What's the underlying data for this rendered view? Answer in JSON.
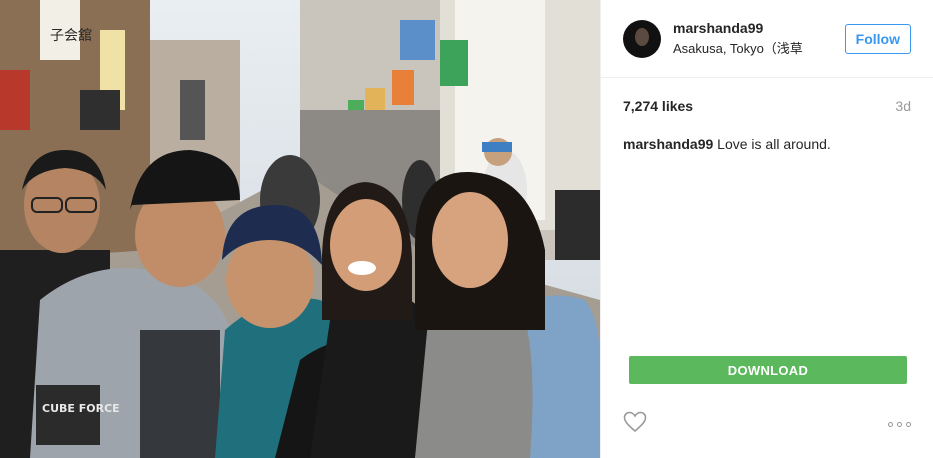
{
  "post": {
    "author": {
      "username": "marshanda99",
      "location": "Asakusa, Tokyo（浅草"
    },
    "follow_label": "Follow",
    "likes": "7,274 likes",
    "time": "3d",
    "caption": {
      "username": "marshanda99",
      "text": "Love is all around."
    },
    "download_label": "DOWNLOAD",
    "photo": {
      "sign_text": "子会舘",
      "hoodie_text": "CUBE FORCE"
    }
  },
  "icons": {
    "like": "heart-outline-icon",
    "more": "more-dots-icon"
  },
  "colors": {
    "follow": "#3897f0",
    "download": "#5cb85c",
    "muted": "#999999"
  }
}
